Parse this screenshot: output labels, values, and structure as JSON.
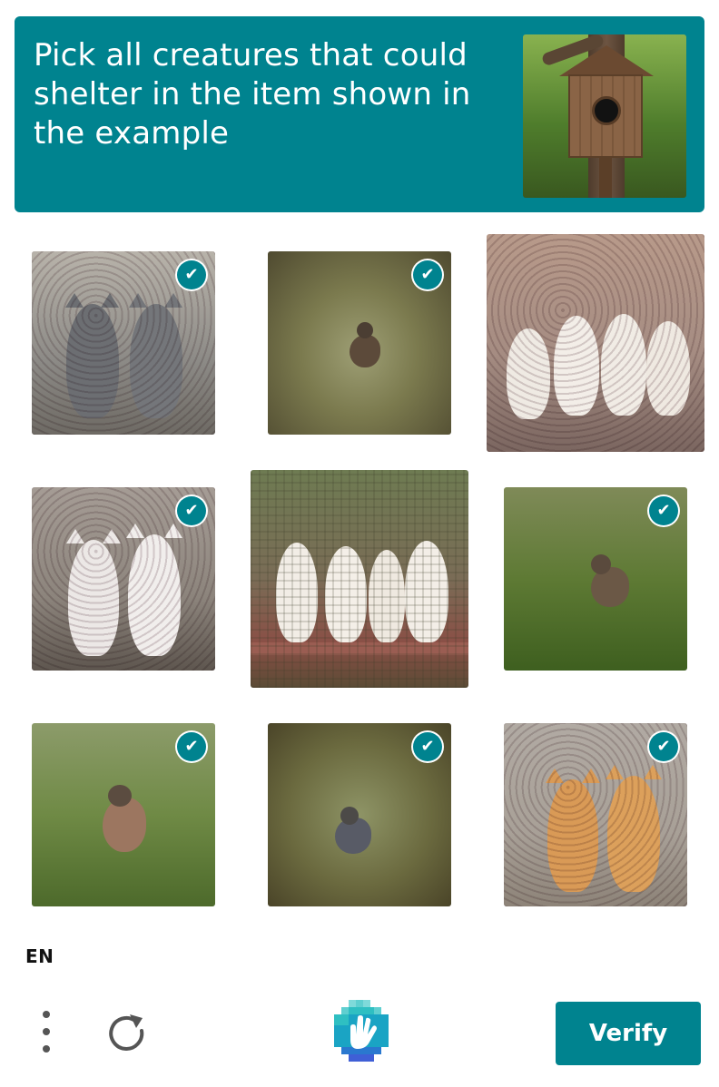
{
  "header": {
    "prompt": "Pick all creatures that could shelter in the item shown in the example",
    "example_image": "birdhouse-on-tree"
  },
  "grid": {
    "tiles": [
      {
        "subject": "two grey cats",
        "selected": true
      },
      {
        "subject": "sparrow on ground",
        "selected": true
      },
      {
        "subject": "four white puppies",
        "selected": false
      },
      {
        "subject": "two white cats",
        "selected": true
      },
      {
        "subject": "four puppies on bench",
        "selected": false
      },
      {
        "subject": "sparrow on grass",
        "selected": true
      },
      {
        "subject": "robin on grass",
        "selected": true
      },
      {
        "subject": "sparrow on ground",
        "selected": true
      },
      {
        "subject": "two orange cats",
        "selected": true
      }
    ],
    "check_glyph": "✔"
  },
  "footer": {
    "language": "EN",
    "menu_icon": "vertical-dots-icon",
    "refresh_icon": "refresh-icon",
    "logo_icon": "hcaptcha-hand-logo",
    "verify_label": "Verify"
  },
  "colors": {
    "accent": "#00838f"
  }
}
